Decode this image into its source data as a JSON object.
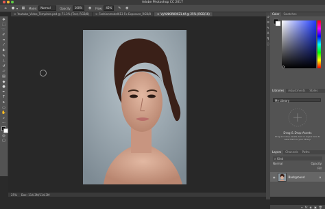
{
  "app": {
    "title": "Adobe Photoshop CC 2017"
  },
  "window_lights": {
    "close": "#ee5c52",
    "minimize": "#f5bd2f",
    "zoom": "#5ecd45"
  },
  "options": {
    "mode_label": "Mode:",
    "mode_value": "Normal",
    "opacity_label": "Opacity:",
    "opacity_value": "100%",
    "flow_label": "Flow:",
    "flow_value": "45%"
  },
  "tabs": [
    {
      "label": "Youtube_Video_Template.psd @ 71.3% (Text, RGB/8)",
      "active": false
    },
    {
      "label": "Fashionmodel613 Fx-Exposure_RGB/8",
      "active": false
    },
    {
      "label": "Vy%NKKW0X21.tif @ 25% (RGB/16)",
      "active": true
    }
  ],
  "status": {
    "zoom": "25%",
    "doc": "Doc: 114.3M/114.3M"
  },
  "panels": {
    "color_tabs": [
      "Color",
      "Swatches"
    ],
    "libraries_tabs": [
      "Libraries",
      "Adjustments",
      "Styles"
    ],
    "library_select": "My Library",
    "dnd_title": "Drag & Drop Assets",
    "dnd_description": "Drag and drop assets, text or layers here to save them to your library.",
    "layers_tabs": [
      "Layers",
      "Channels",
      "Paths"
    ],
    "layer_filter": "Kind",
    "layer_mode": "Normal",
    "layer_opacity_label": "Opacity:",
    "layer_fill_label": "Fill:",
    "layer_name": "Background"
  },
  "colors": {
    "foreground": "#111111",
    "background": "#ffffff",
    "accent": "#2d6cdf"
  },
  "icons": {
    "tools": [
      "move-icon",
      "marquee-icon",
      "lasso-icon",
      "quick-select-icon",
      "crop-icon",
      "eyedropper-icon",
      "healing-icon",
      "brush-icon",
      "clone-stamp-icon",
      "history-brush-icon",
      "eraser-icon",
      "gradient-icon",
      "blur-icon",
      "dodge-icon",
      "pen-icon",
      "type-icon",
      "path-select-icon",
      "rectangle-icon",
      "hand-icon",
      "zoom-icon",
      "more-icon"
    ]
  }
}
